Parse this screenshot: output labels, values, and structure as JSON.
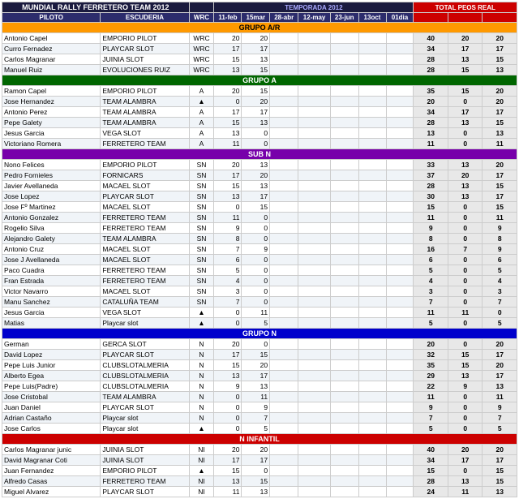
{
  "title": "MUNDIAL RALLY FERRETERO TEAM 2012",
  "subtitle": "TEMPORADA 2012",
  "headers": {
    "piloto": "PILOTO",
    "escuderia": "ESCUDERIA",
    "wrc": "WRC",
    "d11feb": "11-feb",
    "d15mar": "15mar",
    "d28abr": "28-abr",
    "d12may": "12-may",
    "d23jun": "23-jun",
    "d13oct": "13oct",
    "d1dia": "01dia",
    "total": "TOTAL PEOS REAL"
  },
  "groups": [
    {
      "name": "GRUPO A/R",
      "color": "orange",
      "rows": [
        {
          "piloto": "Antonio Capel",
          "escuderia": "EMPORIO PILOT",
          "wrc": "WRC",
          "d1": "20",
          "d2": "20",
          "d3": "",
          "d4": "",
          "d5": "",
          "d6": "",
          "d7": "",
          "t1": "40",
          "t2": "20",
          "t3": "20"
        },
        {
          "piloto": "Curro Fernadez",
          "escuderia": "PLAYCAR SLOT",
          "wrc": "WRC",
          "d1": "17",
          "d2": "17",
          "d3": "",
          "d4": "",
          "d5": "",
          "d6": "",
          "d7": "",
          "t1": "34",
          "t2": "17",
          "t3": "17"
        },
        {
          "piloto": "Carlos Magranar",
          "escuderia": "JUINIA SLOT",
          "wrc": "WRC",
          "d1": "15",
          "d2": "13",
          "d3": "",
          "d4": "",
          "d5": "",
          "d6": "",
          "d7": "",
          "t1": "28",
          "t2": "13",
          "t3": "15"
        },
        {
          "piloto": "Manuel Ruiz",
          "escuderia": "EVOLUCIONES RUIZ",
          "wrc": "WRC",
          "d1": "13",
          "d2": "15",
          "d3": "",
          "d4": "",
          "d5": "",
          "d6": "",
          "d7": "",
          "t1": "28",
          "t2": "15",
          "t3": "13"
        }
      ]
    },
    {
      "name": "GRUPO A",
      "color": "green",
      "rows": [
        {
          "piloto": "Ramon Capel",
          "escuderia": "EMPORIO PILOT",
          "wrc": "A",
          "d1": "20",
          "d2": "15",
          "d3": "",
          "d4": "",
          "d5": "",
          "d6": "",
          "d7": "",
          "t1": "35",
          "t2": "15",
          "t3": "20"
        },
        {
          "piloto": "Jose Hernandez",
          "escuderia": "TEAM ALAMBRA",
          "wrc": "▲",
          "d1": "0",
          "d2": "20",
          "d3": "",
          "d4": "",
          "d5": "",
          "d6": "",
          "d7": "",
          "t1": "20",
          "t2": "0",
          "t3": "20"
        },
        {
          "piloto": "Antonio Perez",
          "escuderia": "TEAM ALAMBRA",
          "wrc": "A",
          "d1": "17",
          "d2": "17",
          "d3": "",
          "d4": "",
          "d5": "",
          "d6": "",
          "d7": "",
          "t1": "34",
          "t2": "17",
          "t3": "17"
        },
        {
          "piloto": "Pepe Galety",
          "escuderia": "TEAM ALAMBRA",
          "wrc": "A",
          "d1": "15",
          "d2": "13",
          "d3": "",
          "d4": "",
          "d5": "",
          "d6": "",
          "d7": "",
          "t1": "28",
          "t2": "13",
          "t3": "15"
        },
        {
          "piloto": "Jesus Garcia",
          "escuderia": "VEGA SLOT",
          "wrc": "A",
          "d1": "13",
          "d2": "0",
          "d3": "",
          "d4": "",
          "d5": "",
          "d6": "",
          "d7": "",
          "t1": "13",
          "t2": "0",
          "t3": "13"
        },
        {
          "piloto": "Victoriano Romera",
          "escuderia": "FERRETERO TEAM",
          "wrc": "A",
          "d1": "11",
          "d2": "0",
          "d3": "",
          "d4": "",
          "d5": "",
          "d6": "",
          "d7": "",
          "t1": "11",
          "t2": "0",
          "t3": "11"
        }
      ]
    },
    {
      "name": "SUB N",
      "color": "purple",
      "rows": [
        {
          "piloto": "Nono Felices",
          "escuderia": "EMPORIO PILOT",
          "wrc": "SN",
          "d1": "20",
          "d2": "13",
          "d3": "",
          "d4": "",
          "d5": "",
          "d6": "",
          "d7": "",
          "t1": "33",
          "t2": "13",
          "t3": "20"
        },
        {
          "piloto": "Pedro Fornieles",
          "escuderia": "FORNICARS",
          "wrc": "SN",
          "d1": "17",
          "d2": "20",
          "d3": "",
          "d4": "",
          "d5": "",
          "d6": "",
          "d7": "",
          "t1": "37",
          "t2": "20",
          "t3": "17"
        },
        {
          "piloto": "Javier Avellaneda",
          "escuderia": "MACAEL SLOT",
          "wrc": "SN",
          "d1": "15",
          "d2": "13",
          "d3": "",
          "d4": "",
          "d5": "",
          "d6": "",
          "d7": "",
          "t1": "28",
          "t2": "13",
          "t3": "15"
        },
        {
          "piloto": "Jose Lopez",
          "escuderia": "PLAYCAR SLOT",
          "wrc": "SN",
          "d1": "13",
          "d2": "17",
          "d3": "",
          "d4": "",
          "d5": "",
          "d6": "",
          "d7": "",
          "t1": "30",
          "t2": "13",
          "t3": "17"
        },
        {
          "piloto": "Jose Fº Martinez",
          "escuderia": "MACAEL SLOT",
          "wrc": "SN",
          "d1": "0",
          "d2": "15",
          "d3": "",
          "d4": "",
          "d5": "",
          "d6": "",
          "d7": "",
          "t1": "15",
          "t2": "0",
          "t3": "15"
        },
        {
          "piloto": "Antonio Gonzalez",
          "escuderia": "FERRETERO TEAM",
          "wrc": "SN",
          "d1": "11",
          "d2": "0",
          "d3": "",
          "d4": "",
          "d5": "",
          "d6": "",
          "d7": "",
          "t1": "11",
          "t2": "0",
          "t3": "11"
        },
        {
          "piloto": "Rogelio Silva",
          "escuderia": "FERRETERO TEAM",
          "wrc": "SN",
          "d1": "9",
          "d2": "0",
          "d3": "",
          "d4": "",
          "d5": "",
          "d6": "",
          "d7": "",
          "t1": "9",
          "t2": "0",
          "t3": "9"
        },
        {
          "piloto": "Alejandro Galety",
          "escuderia": "TEAM ALAMBRA",
          "wrc": "SN",
          "d1": "8",
          "d2": "0",
          "d3": "",
          "d4": "",
          "d5": "",
          "d6": "",
          "d7": "",
          "t1": "8",
          "t2": "0",
          "t3": "8"
        },
        {
          "piloto": "Antonio Cruz",
          "escuderia": "MACAEL SLOT",
          "wrc": "SN",
          "d1": "7",
          "d2": "9",
          "d3": "",
          "d4": "",
          "d5": "",
          "d6": "",
          "d7": "",
          "t1": "16",
          "t2": "7",
          "t3": "9"
        },
        {
          "piloto": "Jose J Avellaneda",
          "escuderia": "MACAEL SLOT",
          "wrc": "SN",
          "d1": "6",
          "d2": "0",
          "d3": "",
          "d4": "",
          "d5": "",
          "d6": "",
          "d7": "",
          "t1": "6",
          "t2": "0",
          "t3": "6"
        },
        {
          "piloto": "Paco Cuadra",
          "escuderia": "FERRETERO TEAM",
          "wrc": "SN",
          "d1": "5",
          "d2": "0",
          "d3": "",
          "d4": "",
          "d5": "",
          "d6": "",
          "d7": "",
          "t1": "5",
          "t2": "0",
          "t3": "5"
        },
        {
          "piloto": "Fran Estrada",
          "escuderia": "FERRETERO TEAM",
          "wrc": "SN",
          "d1": "4",
          "d2": "0",
          "d3": "",
          "d4": "",
          "d5": "",
          "d6": "",
          "d7": "",
          "t1": "4",
          "t2": "0",
          "t3": "4"
        },
        {
          "piloto": "Victor Navarro",
          "escuderia": "MACAEL SLOT",
          "wrc": "SN",
          "d1": "3",
          "d2": "0",
          "d3": "",
          "d4": "",
          "d5": "",
          "d6": "",
          "d7": "",
          "t1": "3",
          "t2": "0",
          "t3": "3"
        },
        {
          "piloto": "Manu Sanchez",
          "escuderia": "CATALUÑA TEAM",
          "wrc": "SN",
          "d1": "7",
          "d2": "0",
          "d3": "",
          "d4": "",
          "d5": "",
          "d6": "",
          "d7": "",
          "t1": "7",
          "t2": "0",
          "t3": "7"
        },
        {
          "piloto": "Jesus Garcia",
          "escuderia": "VEGA SLOT",
          "wrc": "▲",
          "d1": "0",
          "d2": "11",
          "d3": "",
          "d4": "",
          "d5": "",
          "d6": "",
          "d7": "",
          "t1": "11",
          "t2": "11",
          "t3": "0"
        },
        {
          "piloto": "Matias",
          "escuderia": "Playcar slot",
          "wrc": "▲",
          "d1": "0",
          "d2": "5",
          "d3": "",
          "d4": "",
          "d5": "",
          "d6": "",
          "d7": "",
          "t1": "5",
          "t2": "0",
          "t3": "5"
        }
      ]
    },
    {
      "name": "GRUPO N",
      "color": "blue",
      "rows": [
        {
          "piloto": "German",
          "escuderia": "GERCA SLOT",
          "wrc": "N",
          "d1": "20",
          "d2": "0",
          "d3": "",
          "d4": "",
          "d5": "",
          "d6": "",
          "d7": "",
          "t1": "20",
          "t2": "0",
          "t3": "20"
        },
        {
          "piloto": "David Lopez",
          "escuderia": "PLAYCAR SLOT",
          "wrc": "N",
          "d1": "17",
          "d2": "15",
          "d3": "",
          "d4": "",
          "d5": "",
          "d6": "",
          "d7": "",
          "t1": "32",
          "t2": "15",
          "t3": "17"
        },
        {
          "piloto": "Pepe Luis Junior",
          "escuderia": "CLUBSLOTALMERIA",
          "wrc": "N",
          "d1": "15",
          "d2": "20",
          "d3": "",
          "d4": "",
          "d5": "",
          "d6": "",
          "d7": "",
          "t1": "35",
          "t2": "15",
          "t3": "20"
        },
        {
          "piloto": "Alberto Egea",
          "escuderia": "CLUBSLOTALMERIA",
          "wrc": "N",
          "d1": "13",
          "d2": "17",
          "d3": "",
          "d4": "",
          "d5": "",
          "d6": "",
          "d7": "",
          "t1": "29",
          "t2": "13",
          "t3": "17"
        },
        {
          "piloto": "Pepe Luis(Padre)",
          "escuderia": "CLUBSLOTALMERIA",
          "wrc": "N",
          "d1": "9",
          "d2": "13",
          "d3": "",
          "d4": "",
          "d5": "",
          "d6": "",
          "d7": "",
          "t1": "22",
          "t2": "9",
          "t3": "13"
        },
        {
          "piloto": "Jose Cristobal",
          "escuderia": "TEAM ALAMBRA",
          "wrc": "N",
          "d1": "0",
          "d2": "11",
          "d3": "",
          "d4": "",
          "d5": "",
          "d6": "",
          "d7": "",
          "t1": "11",
          "t2": "0",
          "t3": "11"
        },
        {
          "piloto": "Juan Daniel",
          "escuderia": "PLAYCAR SLOT",
          "wrc": "N",
          "d1": "0",
          "d2": "9",
          "d3": "",
          "d4": "",
          "d5": "",
          "d6": "",
          "d7": "",
          "t1": "9",
          "t2": "0",
          "t3": "9"
        },
        {
          "piloto": "Adrian Castaño",
          "escuderia": "Playcar slot",
          "wrc": "N",
          "d1": "0",
          "d2": "7",
          "d3": "",
          "d4": "",
          "d5": "",
          "d6": "",
          "d7": "",
          "t1": "7",
          "t2": "0",
          "t3": "7"
        },
        {
          "piloto": "Jose Carlos",
          "escuderia": "Playcar slot",
          "wrc": "▲",
          "d1": "0",
          "d2": "5",
          "d3": "",
          "d4": "",
          "d5": "",
          "d6": "",
          "d7": "",
          "t1": "5",
          "t2": "0",
          "t3": "5"
        }
      ]
    },
    {
      "name": "N INFANTIL",
      "color": "red",
      "rows": [
        {
          "piloto": "Carlos Magranar junic",
          "escuderia": "JUINIA SLOT",
          "wrc": "NI",
          "d1": "20",
          "d2": "20",
          "d3": "",
          "d4": "",
          "d5": "",
          "d6": "",
          "d7": "",
          "t1": "40",
          "t2": "20",
          "t3": "20"
        },
        {
          "piloto": "David Magranar Coti",
          "escuderia": "JUINIA SLOT",
          "wrc": "NI",
          "d1": "17",
          "d2": "17",
          "d3": "",
          "d4": "",
          "d5": "",
          "d6": "",
          "d7": "",
          "t1": "34",
          "t2": "17",
          "t3": "17"
        },
        {
          "piloto": "Juan Fernandez",
          "escuderia": "EMPORIO PILOT",
          "wrc": "▲",
          "d1": "15",
          "d2": "0",
          "d3": "",
          "d4": "",
          "d5": "",
          "d6": "",
          "d7": "",
          "t1": "15",
          "t2": "0",
          "t3": "15"
        },
        {
          "piloto": "Alfredo Casas",
          "escuderia": "FERRETERO TEAM",
          "wrc": "NI",
          "d1": "13",
          "d2": "15",
          "d3": "",
          "d4": "",
          "d5": "",
          "d6": "",
          "d7": "",
          "t1": "28",
          "t2": "13",
          "t3": "15"
        },
        {
          "piloto": "Miguel Alvarez",
          "escuderia": "PLAYCAR SLOT",
          "wrc": "NI",
          "d1": "11",
          "d2": "13",
          "d3": "",
          "d4": "",
          "d5": "",
          "d6": "",
          "d7": "",
          "t1": "24",
          "t2": "11",
          "t3": "13"
        }
      ]
    }
  ]
}
